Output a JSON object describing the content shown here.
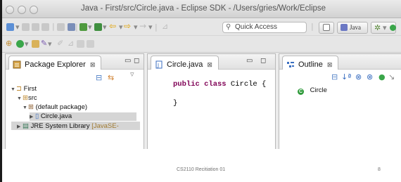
{
  "window": {
    "title": "Java - First/src/Circle.java - Eclipse SDK - /Users/gries/Work/Eclipse"
  },
  "toolbar": {
    "quick_access_placeholder": "Quick Access",
    "perspective_java_label": "Java"
  },
  "package_explorer": {
    "tab_label": "Package Explorer",
    "close_glyph": "⊠",
    "tree": [
      {
        "label": "First",
        "depth": 0,
        "expanded": true,
        "icon": "project-icon"
      },
      {
        "label": "src",
        "depth": 1,
        "expanded": true,
        "icon": "source-folder-icon"
      },
      {
        "label": "(default package)",
        "depth": 2,
        "expanded": true,
        "icon": "package-icon"
      },
      {
        "label": "Circle.java",
        "depth": 3,
        "expanded": false,
        "icon": "java-file-icon",
        "selected": true
      },
      {
        "label": "JRE System Library",
        "suffix": "[JavaSE-",
        "depth": 1,
        "expanded": false,
        "icon": "library-icon"
      }
    ]
  },
  "editor": {
    "tab_label": "Circle.java",
    "close_glyph": "⊠",
    "code_line1_kw": "public class",
    "code_line1_rest": " Circle {",
    "code_line2": "}"
  },
  "outline": {
    "tab_label": "Outline",
    "close_glyph": "⊠",
    "class_item": "Circle"
  },
  "footer": {
    "center": "CS2110 Recitiation 01",
    "page_number": "8"
  },
  "colors": {
    "keyword": "#7f0055",
    "class_green": "#2e9a3a",
    "selection": "#d5d5d5"
  }
}
